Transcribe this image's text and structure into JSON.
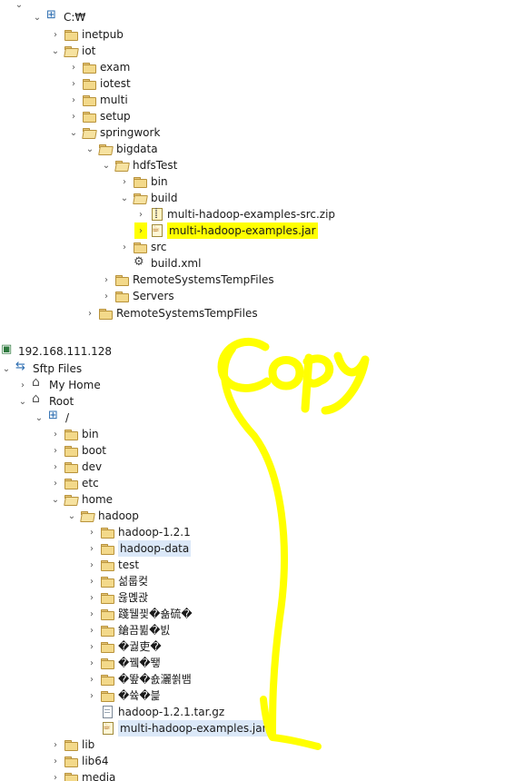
{
  "top_tree": {
    "drive": "C:₩",
    "items": [
      {
        "label": "inetpub"
      },
      {
        "label": "iot"
      },
      {
        "label": "exam"
      },
      {
        "label": "iotest"
      },
      {
        "label": "multi"
      },
      {
        "label": "setup"
      },
      {
        "label": "springwork"
      },
      {
        "label": "bigdata"
      },
      {
        "label": "hdfsTest"
      },
      {
        "label": "bin"
      },
      {
        "label": "build"
      },
      {
        "label": "multi-hadoop-examples-src.zip"
      },
      {
        "label": "multi-hadoop-examples.jar"
      },
      {
        "label": "src"
      },
      {
        "label": "build.xml"
      },
      {
        "label": "RemoteSystemsTempFiles"
      },
      {
        "label": "Servers"
      },
      {
        "label": "RemoteSystemsTempFiles"
      }
    ]
  },
  "bottom_tree": {
    "host": "192.168.111.128",
    "items": [
      {
        "label": "Sftp Files"
      },
      {
        "label": "My Home"
      },
      {
        "label": "Root"
      },
      {
        "label": "/"
      },
      {
        "label": "bin"
      },
      {
        "label": "boot"
      },
      {
        "label": "dev"
      },
      {
        "label": "etc"
      },
      {
        "label": "home"
      },
      {
        "label": "hadoop"
      },
      {
        "label": "hadoop-1.2.1"
      },
      {
        "label": "hadoop-data"
      },
      {
        "label": "test"
      },
      {
        "label": "섦룹컺"
      },
      {
        "label": "윦몑괁"
      },
      {
        "label": "踐뒐끷�숆硫�"
      },
      {
        "label": "鎗끔뷞�빐"
      },
      {
        "label": "�궗吏�"
      },
      {
        "label": "�뀈�뙣"
      },
      {
        "label": "�뙆�숈灑쐵뱀"
      },
      {
        "label": "�쓬�븙"
      },
      {
        "label": "hadoop-1.2.1.tar.gz"
      },
      {
        "label": "multi-hadoop-examples.jar"
      },
      {
        "label": "lib"
      },
      {
        "label": "lib64"
      },
      {
        "label": "media"
      }
    ]
  },
  "annotation": {
    "text": "Copy",
    "color": "#ffff00"
  }
}
